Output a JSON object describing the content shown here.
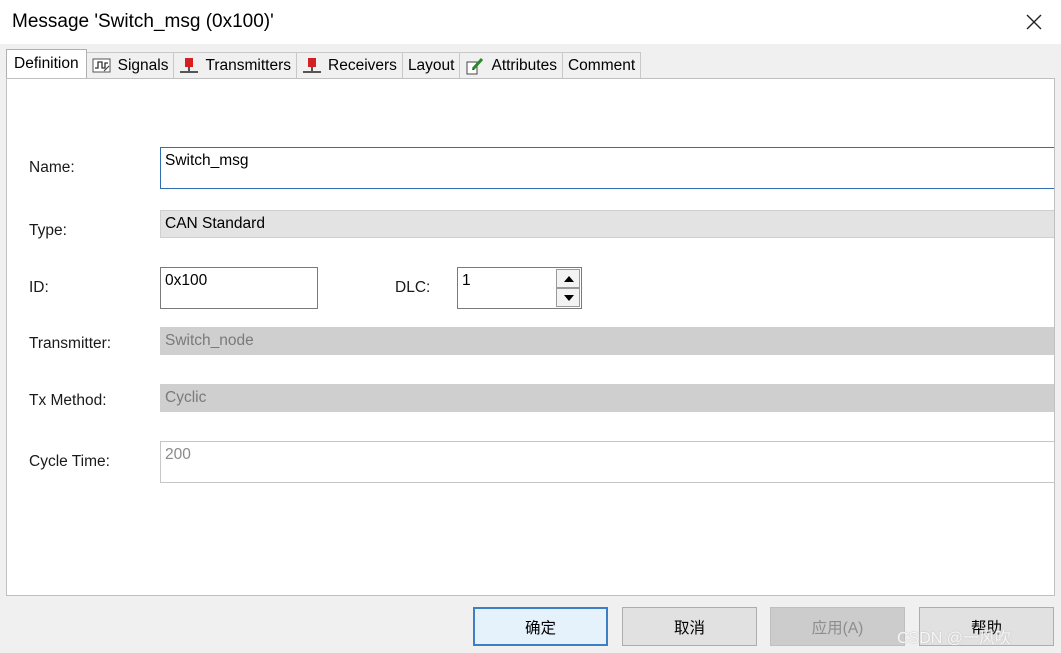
{
  "window": {
    "title": "Message 'Switch_msg (0x100)'"
  },
  "tabs": [
    {
      "label": "Definition",
      "icon": "none",
      "active": true
    },
    {
      "label": "Signals",
      "icon": "signal-waveform-icon",
      "active": false
    },
    {
      "label": "Transmitters",
      "icon": "network-node-icon",
      "active": false
    },
    {
      "label": "Receivers",
      "icon": "network-node-icon",
      "active": false
    },
    {
      "label": "Layout",
      "icon": "none",
      "active": false
    },
    {
      "label": "Attributes",
      "icon": "pencil-icon",
      "active": false
    },
    {
      "label": "Comment",
      "icon": "none",
      "active": false
    }
  ],
  "form": {
    "name_label": "Name:",
    "name_value": "Switch_msg",
    "type_label": "Type:",
    "type_value": "CAN Standard",
    "id_label": "ID:",
    "id_value": "0x100",
    "dlc_label": "DLC:",
    "dlc_value": "1",
    "transmitter_label": "Transmitter:",
    "transmitter_value": "Switch_node",
    "tx_method_label": "Tx Method:",
    "tx_method_value": "Cyclic",
    "cycle_time_label": "Cycle Time:",
    "cycle_time_value": "200"
  },
  "buttons": {
    "ok": "确定",
    "cancel": "取消",
    "apply": "应用(A)",
    "help": "帮助"
  },
  "watermark": "CSDN @一风吹",
  "colors": {
    "accent": "#2f6fb0",
    "node_icon_red": "#d42020"
  }
}
